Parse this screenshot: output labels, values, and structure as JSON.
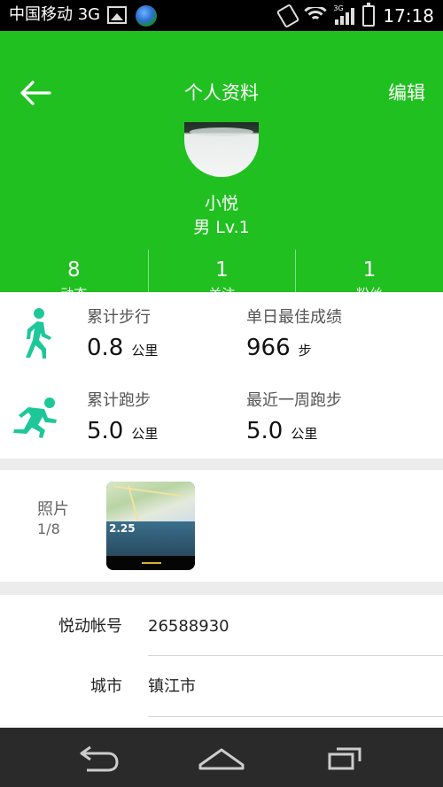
{
  "status_bar": {
    "carrier": "中国移动 3G",
    "network_badge": "3G",
    "time": "17:18",
    "icons": [
      "picture-icon",
      "globe-icon",
      "vibrate-icon",
      "wifi-icon",
      "signal-icon",
      "battery-icon"
    ]
  },
  "header": {
    "title": "个人资料",
    "edit_label": "编辑",
    "back_icon": "back-arrow-icon"
  },
  "profile": {
    "name": "小悦",
    "gender_level": "男  Lv.1"
  },
  "stats": [
    {
      "value": "8",
      "label": "动态"
    },
    {
      "value": "1",
      "label": "关注"
    },
    {
      "value": "1",
      "label": "粉丝"
    }
  ],
  "activity": {
    "walk": {
      "total_label": "累计步行",
      "total_value": "0.8",
      "total_unit": "公里",
      "best_label": "单日最佳成绩",
      "best_value": "966",
      "best_unit": "步"
    },
    "run": {
      "total_label": "累计跑步",
      "total_value": "5.0",
      "total_unit": "公里",
      "week_label": "最近一周跑步",
      "week_value": "5.0",
      "week_unit": "公里"
    }
  },
  "photos": {
    "label": "照片",
    "count": "1/8",
    "thumb_value": "2.25"
  },
  "account": {
    "rows": [
      {
        "label": "悦动帐号",
        "value": "26588930"
      },
      {
        "label": "城市",
        "value": "镇江市"
      }
    ]
  },
  "navigation": {
    "buttons": [
      "back-icon",
      "home-icon",
      "recent-apps-icon"
    ]
  },
  "colors": {
    "brand_green": "#21c021",
    "icon_teal": "#1ec79a",
    "nav_bar": "#2a2a2a"
  }
}
